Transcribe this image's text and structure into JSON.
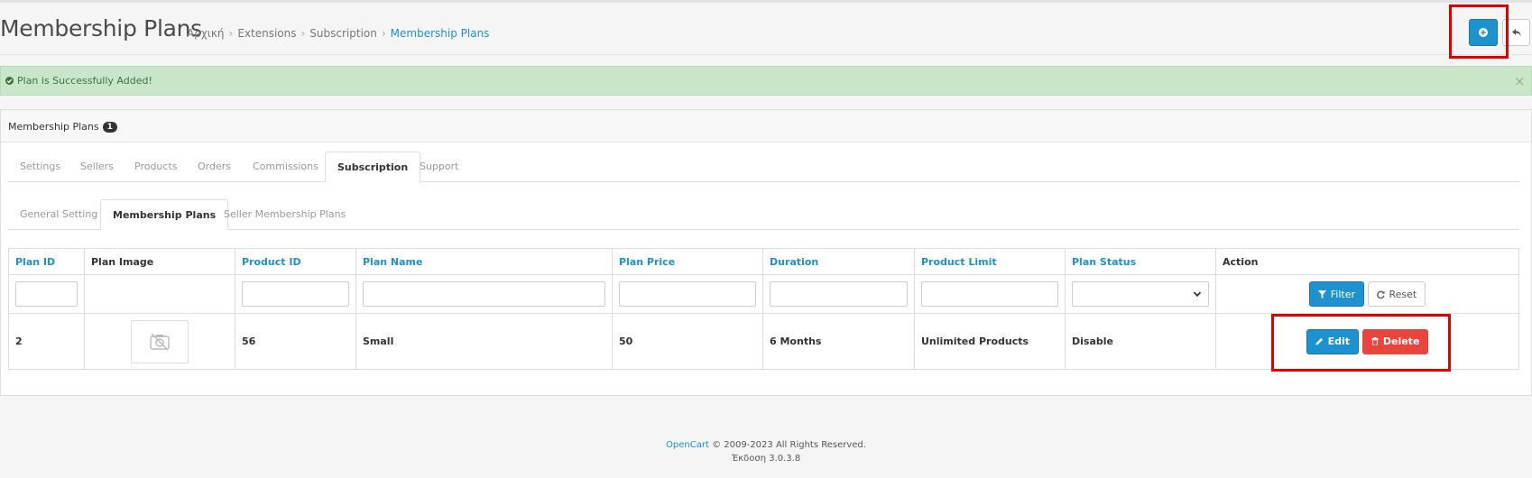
{
  "header": {
    "title": "Membership Plans",
    "breadcrumb": [
      "Αρχική",
      "Extensions",
      "Subscription",
      "Membership Plans"
    ]
  },
  "toolbar": {
    "add_icon": "plus-circle-icon",
    "back_icon": "reply-icon"
  },
  "alert": {
    "message": "Plan is Successfully Added!",
    "close": "×"
  },
  "panel": {
    "title": "Membership Plans",
    "count": "1"
  },
  "tabs": [
    "Settings",
    "Sellers",
    "Products",
    "Orders",
    "Commissions",
    "Subscription",
    "Support"
  ],
  "active_tab": "Subscription",
  "subtabs": [
    "General Setting",
    "Membership Plans",
    "Seller Membership Plans"
  ],
  "active_subtab": "Membership Plans",
  "table": {
    "columns": [
      "Plan ID",
      "Plan Image",
      "Product ID",
      "Plan Name",
      "Plan Price",
      "Duration",
      "Product Limit",
      "Plan Status",
      "Action"
    ],
    "filter_label": "Filter",
    "reset_label": "Reset",
    "rows": [
      {
        "plan_id": "2",
        "product_id": "56",
        "plan_name": "Small",
        "plan_price": "50",
        "duration": "6 Months",
        "product_limit": "Unlimited Products",
        "plan_status": "Disable",
        "edit_label": "Edit",
        "delete_label": "Delete"
      }
    ]
  },
  "footer": {
    "link": "OpenCart",
    "copyright": "© 2009-2023 All Rights Reserved.",
    "version": "Έκδοση 3.0.3.8"
  },
  "colors": {
    "primary": "#1e91cf",
    "danger": "#e8453c",
    "success_bg": "#c9e6ca",
    "highlight": "#e00000"
  }
}
